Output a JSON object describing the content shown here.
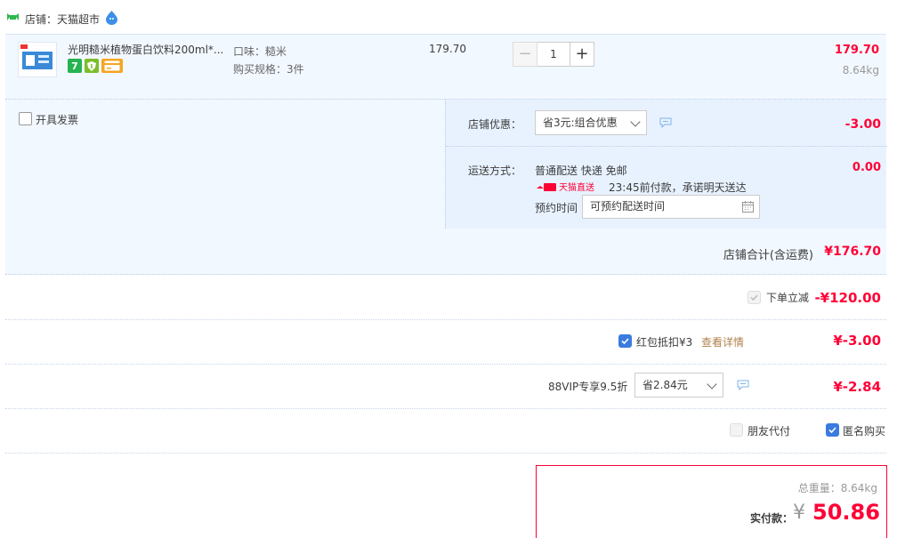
{
  "shop": {
    "label": "店铺：天猫超市"
  },
  "item": {
    "title": "光明糙米植物蛋白饮料200ml*...",
    "badge_7": "7",
    "flavor": "口味：糙米",
    "spec": "购买规格：3件",
    "unit_price": "179.70",
    "quantity": "1",
    "minus_label": "−",
    "plus_label": "+",
    "total": "179.70",
    "weight": "8.64kg"
  },
  "invoice": {
    "label": "开具发票"
  },
  "promo": {
    "label": "店铺优惠：",
    "selected": "省3元:组合优惠",
    "amount": "-3.00"
  },
  "shipping": {
    "label": "运送方式：",
    "method": "普通配送 快递 免邮",
    "badge_text": "天猫直送",
    "promise": "23:45前付款，承诺明天送达",
    "booking_label": "预约时间",
    "booking_placeholder": "可预约配送时间",
    "amount": "0.00"
  },
  "shop_total": {
    "label": "店铺合计(含运费)",
    "value": "¥176.70"
  },
  "order_discount": {
    "label": "下单立减",
    "amount": "-¥120.00"
  },
  "red_packet": {
    "label": "红包抵扣¥3",
    "link": "查看详情",
    "amount": "¥-3.00"
  },
  "vip": {
    "label": "88VIP专享9.5折",
    "selected": "省2.84元",
    "amount": "¥-2.84"
  },
  "pay_options": {
    "friend_pay": "朋友代付",
    "anonymous": "匿名购买"
  },
  "summary": {
    "weight": "总重量：8.64kg",
    "pay_label": "实付款：",
    "currency": "¥",
    "amount": "50.86"
  },
  "colors": {
    "accent": "#ff0036",
    "panel": "#f2f8ff",
    "check_blue": "#3a7be0"
  }
}
